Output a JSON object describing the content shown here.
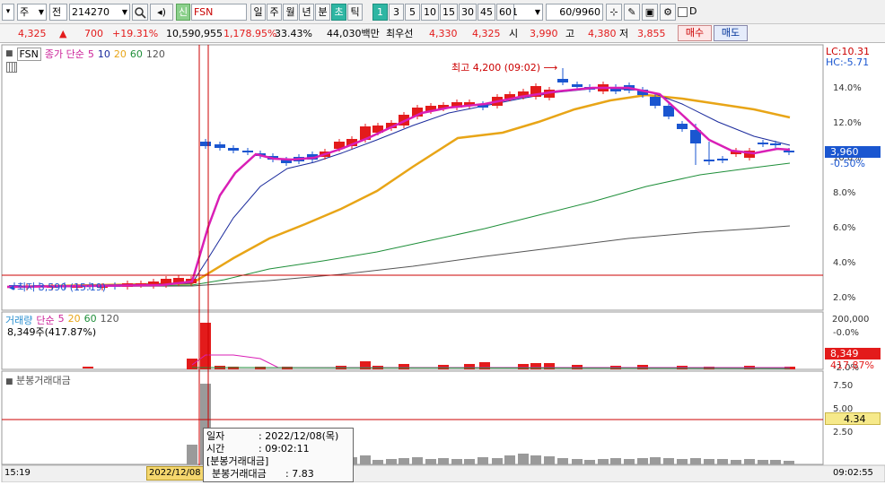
{
  "toolbar": {
    "mode": "주",
    "kind": "전",
    "code": "214270",
    "badge": "신",
    "name": "FSN",
    "periods": [
      "일",
      "주",
      "월",
      "년",
      "분",
      "초",
      "틱"
    ],
    "active_period": "초",
    "intervals": [
      "1",
      "3",
      "5",
      "10",
      "15",
      "30",
      "45",
      "60"
    ],
    "active_interval": "1",
    "count": "1",
    "range": "60/9960",
    "checkbox_label": "D"
  },
  "quote": {
    "price": "4,325",
    "change_sign": "▲",
    "change": "700",
    "change_pct": "+19.31%",
    "volume": "10,590,955",
    "volume_ratio": "1,178.95%",
    "turnover": "33.43%",
    "amount": "44,030백만",
    "best_label": "최우선",
    "best_ask": "4,330",
    "best_bid": "4,325",
    "open_label": "시",
    "open": "3,990",
    "high_label": "고",
    "high": "4,380",
    "low_label": "저",
    "low": "3,855",
    "buy_label": "매수",
    "sell_label": "매도"
  },
  "price_pane": {
    "symbol": "FSN",
    "indicator": "종가 단순",
    "ma_periods": [
      "5",
      "10",
      "20",
      "60",
      "120"
    ],
    "ma_colors": [
      "#cc2299",
      "#1a2a9c",
      "#e8a517",
      "#1f8f3a",
      "#555555"
    ],
    "lc": "LC:10.31",
    "hc": "HC:-5.71",
    "high_annotation": "최고 4,200 (09:02)",
    "low_annotation": "최저 3,590 (15:19)",
    "current_price": "3,960",
    "current_pct": "-0.50%",
    "y_ticks": [
      "14.0%",
      "12.0%",
      "10.0%",
      "8.0%",
      "6.0%",
      "4.0%",
      "2.0%",
      "-0.0%",
      "-2.0%"
    ]
  },
  "volume_pane": {
    "title": "거래량",
    "indicator": "단순",
    "ma_periods": [
      "5",
      "20",
      "60",
      "120"
    ],
    "info": "8,349주(417.87%)",
    "y_tick": "200,000",
    "current_value": "8,349",
    "current_pct": "417.87%"
  },
  "amount_pane": {
    "title": "분봉거래대금",
    "y_ticks": [
      "7.50",
      "5.00",
      "2.50"
    ],
    "current_value": "4.34"
  },
  "time_axis": {
    "left_time": "15:19",
    "cursor_date": "2022/12/08",
    "right_time": "09:02:55"
  },
  "tooltip": {
    "rows": [
      {
        "label": "일자",
        "value": ": 2022/12/08(목)"
      },
      {
        "label": "시간",
        "value": ": 09:02:11"
      },
      {
        "label": "[분봉거래대금]",
        "value": ""
      },
      {
        "label": "분봉거래대금",
        "value": ": 7.83"
      }
    ]
  },
  "colors": {
    "up": "#e31b1b",
    "down": "#1a56d0",
    "accent": "#2eb6a3"
  }
}
